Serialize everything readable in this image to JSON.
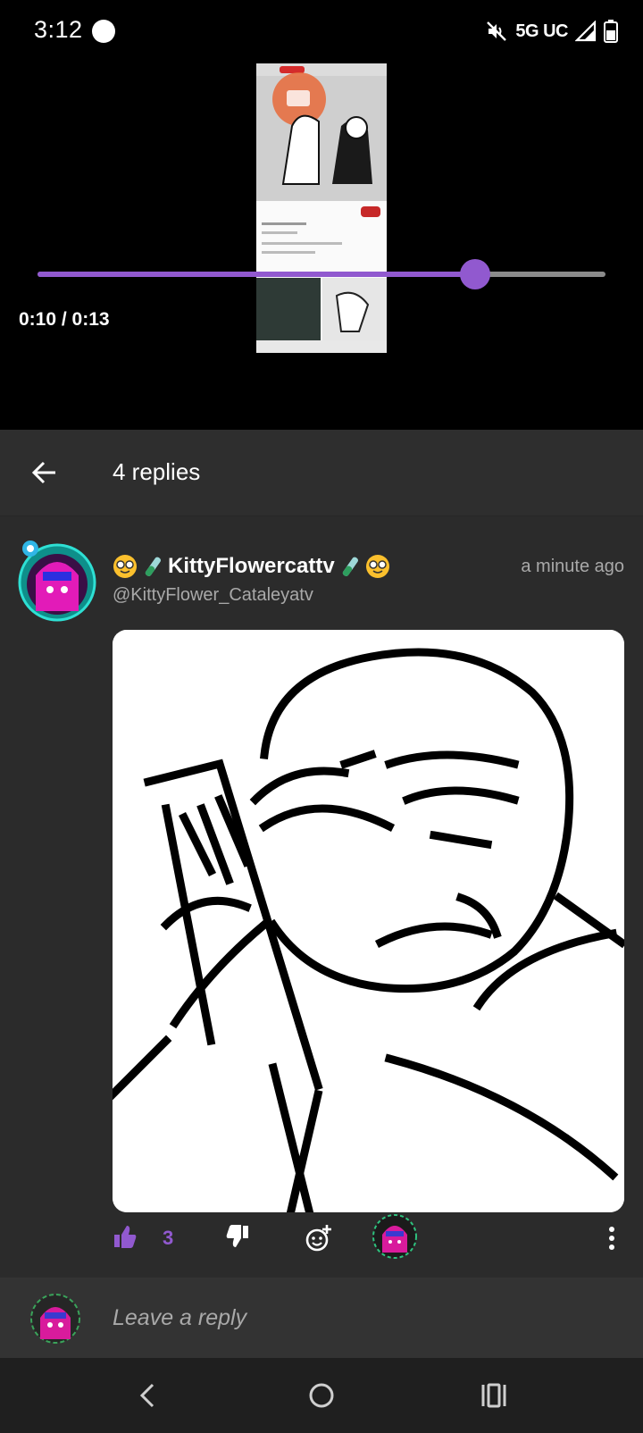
{
  "status_bar": {
    "time": "3:12",
    "network": "5G UC"
  },
  "video": {
    "time_display": "0:10 / 0:13",
    "progress": 0.77
  },
  "header": {
    "title": "4 replies"
  },
  "comment": {
    "author_name": "KittyFlowercattv",
    "author_handle": "@KittyFlower_Cataleyatv",
    "timestamp": "a minute ago",
    "like_count": "3"
  },
  "reply": {
    "placeholder": "Leave a reply"
  },
  "colors": {
    "accent": "#9159cf",
    "header_bg": "#2e2e2e",
    "content_bg": "#2b2b2b",
    "muted_text": "#a9a9a9"
  },
  "icons": {
    "status": [
      "mute-icon",
      "signal-icon",
      "battery-icon"
    ],
    "actions": [
      "thumbs-up-icon",
      "thumbs-down-icon",
      "add-reaction-icon",
      "more-vert-icon"
    ],
    "nav": [
      "back-chevron-icon",
      "home-circle-icon",
      "recents-icon"
    ]
  }
}
